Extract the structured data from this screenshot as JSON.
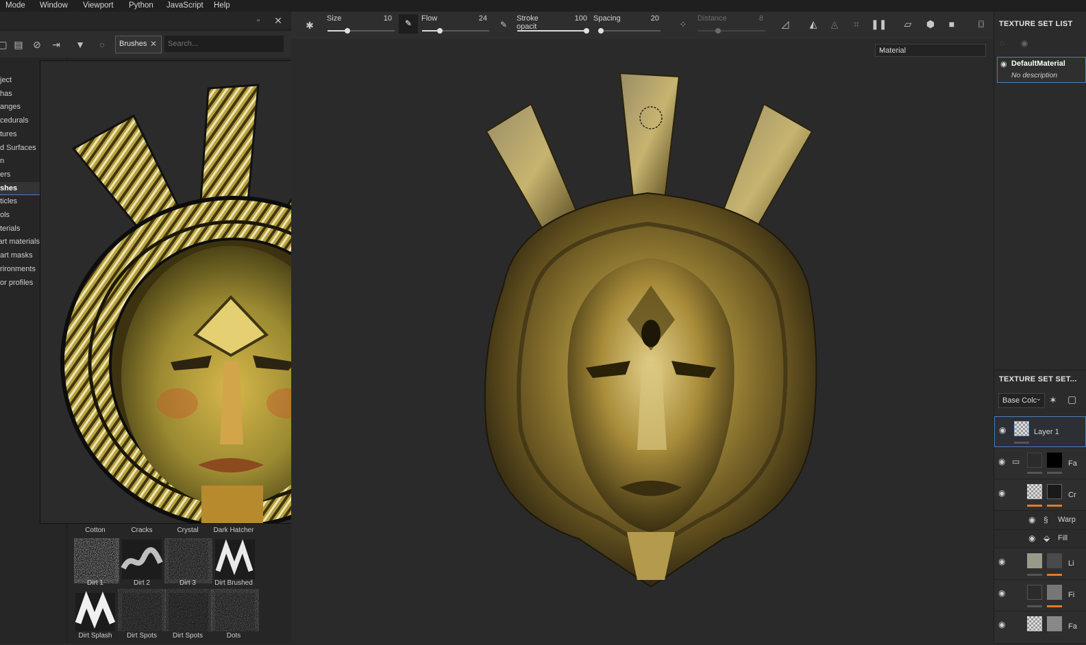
{
  "menu": [
    "Mode",
    "Window",
    "Viewport",
    "Python",
    "JavaScript",
    "Help"
  ],
  "shelf": {
    "filter_tag": "Brushes",
    "search_placeholder": "Search...",
    "categories": [
      {
        "label": "ject"
      },
      {
        "label": "has"
      },
      {
        "label": "anges"
      },
      {
        "label": "cedurals"
      },
      {
        "label": "tures"
      },
      {
        "label": "d Surfaces"
      },
      {
        "label": "n"
      },
      {
        "label": "ers"
      },
      {
        "label": "shes",
        "selected": true
      },
      {
        "label": "ticles"
      },
      {
        "label": "ols"
      },
      {
        "label": "terials"
      },
      {
        "label": "art materials"
      },
      {
        "label": "art masks"
      },
      {
        "label": "rironments"
      },
      {
        "label": "or profiles"
      }
    ],
    "brush_row1_labels": [
      "Cotton",
      "Cracks",
      "Crystal",
      "Dark Hatcher"
    ],
    "brush_row2_labels": [
      "Dirt 1",
      "Dirt 2",
      "Dirt 3",
      "Dirt Brushed"
    ],
    "brush_row3_labels": [
      "Dirt Splash",
      "Dirt Spots",
      "Dirt Spots",
      "Dots"
    ]
  },
  "toolbar": {
    "size": {
      "label": "Size",
      "value": "10",
      "fraction": 0.3
    },
    "flow": {
      "label": "Flow",
      "value": "24",
      "fraction": 0.27
    },
    "stroke_opacity": {
      "label": "Stroke opacit",
      "value": "100",
      "fraction": 1.0
    },
    "spacing": {
      "label": "Spacing",
      "value": "20",
      "fraction": 0.03
    },
    "distance": {
      "label": "Distance",
      "value": "8",
      "fraction": 0.3
    }
  },
  "viewport": {
    "channel": "Material"
  },
  "texture_set_list": {
    "title": "TEXTURE SET LIST",
    "item_name": "DefaultMaterial",
    "item_desc": "No description"
  },
  "texture_set_settings": {
    "title": "TEXTURE SET SET...",
    "channel": "Base Colc"
  },
  "layers": [
    {
      "name": "Layer 1"
    },
    {
      "name": "Fa"
    },
    {
      "name": "Cr"
    },
    {
      "name": "Warp"
    },
    {
      "name": "Fill"
    },
    {
      "name": "Li"
    },
    {
      "name": "Fi"
    },
    {
      "name": "Fa"
    }
  ],
  "colors": {
    "accent": "#4c7fc2",
    "mask_bar": "#e27a2c",
    "gold": "#b8a248"
  }
}
